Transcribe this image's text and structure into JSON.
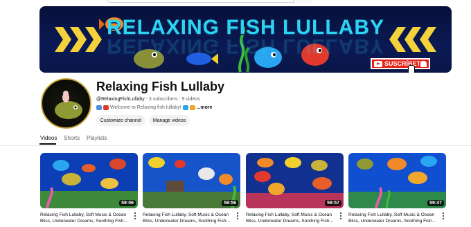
{
  "banner": {
    "title": "RELAXING FISH LULLABY",
    "subscribe_label": "SUSCRÍBETE"
  },
  "channel": {
    "name": "Relaxing Fish Lullaby",
    "handle": "@RelaxingFishLullaby",
    "separator_1": " ‧ ",
    "subscribers": "3 subscribers",
    "separator_2": " ‧ ",
    "videos": "9 videos",
    "description": "Welcome to Relaxing fish lullaby!",
    "more_label": "...more",
    "customize_label": "Customize channel",
    "manage_label": "Manage videos"
  },
  "tabs": [
    {
      "label": "Videos",
      "active": true
    },
    {
      "label": "Shorts",
      "active": false
    },
    {
      "label": "Playlists",
      "active": false
    }
  ],
  "videos": [
    {
      "title": "Relaxing Fish Lullaby, Soft Music & Ocean Bliss, Underwater Dreams, Soothing Fish...",
      "duration": "59:06"
    },
    {
      "title": "Relaxing Fish Lullaby, Soft Music & Ocean Bliss, Underwater Dreams, Soothing Fish...",
      "duration": "59:56"
    },
    {
      "title": "Relaxing Fish Lullaby, Soft Music & Ocean Bliss, Underwater Dreams, Soothing Fish...",
      "duration": "59:57"
    },
    {
      "title": "Relaxing Fish Lullaby, Soft Music & Ocean Bliss, Underwater Dreams, Soothing Fish...",
      "duration": "59:47"
    }
  ],
  "icons": {
    "more_actions": "kebab-vertical-icon",
    "subscribe": "youtube-play-icon",
    "bell": "bell-icon"
  },
  "colors": {
    "banner_text": "#2cd4f0",
    "chevrons": "#f3d23b",
    "subscribe_red": "#e62117",
    "duration_bg": "#000000"
  }
}
